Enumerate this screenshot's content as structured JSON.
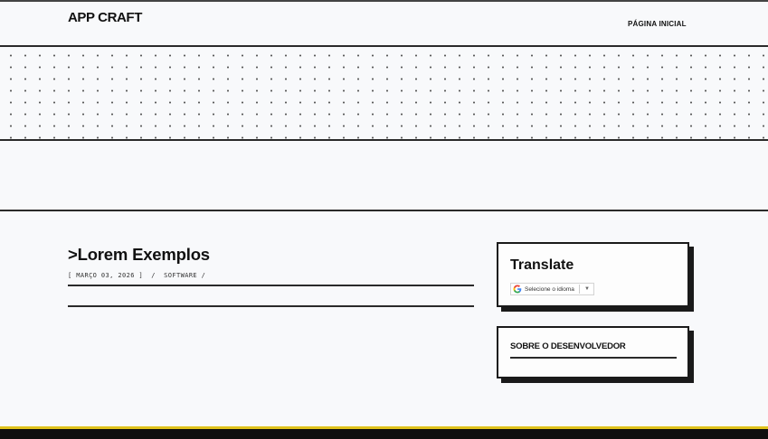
{
  "header": {
    "logo": "APP CRAFT",
    "nav_home": "PÁGINA INICIAL"
  },
  "post": {
    "title": ">Lorem Exemplos",
    "meta": "[ MARÇO 03, 2026 ]  /  SOFTWARE /"
  },
  "sidebar": {
    "translate": {
      "title": "Translate",
      "select_label": "Selecione o idioma",
      "caret": "▼"
    },
    "about": {
      "title": "SOBRE O DESENVOLVEDOR"
    }
  },
  "colors": {
    "background": "#f8f9fb",
    "ink": "#1a1a1a",
    "footer": "#0f0f0f",
    "footer_accent": "#e0c21c"
  },
  "icons": {
    "translate_provider": "google-g-icon"
  }
}
